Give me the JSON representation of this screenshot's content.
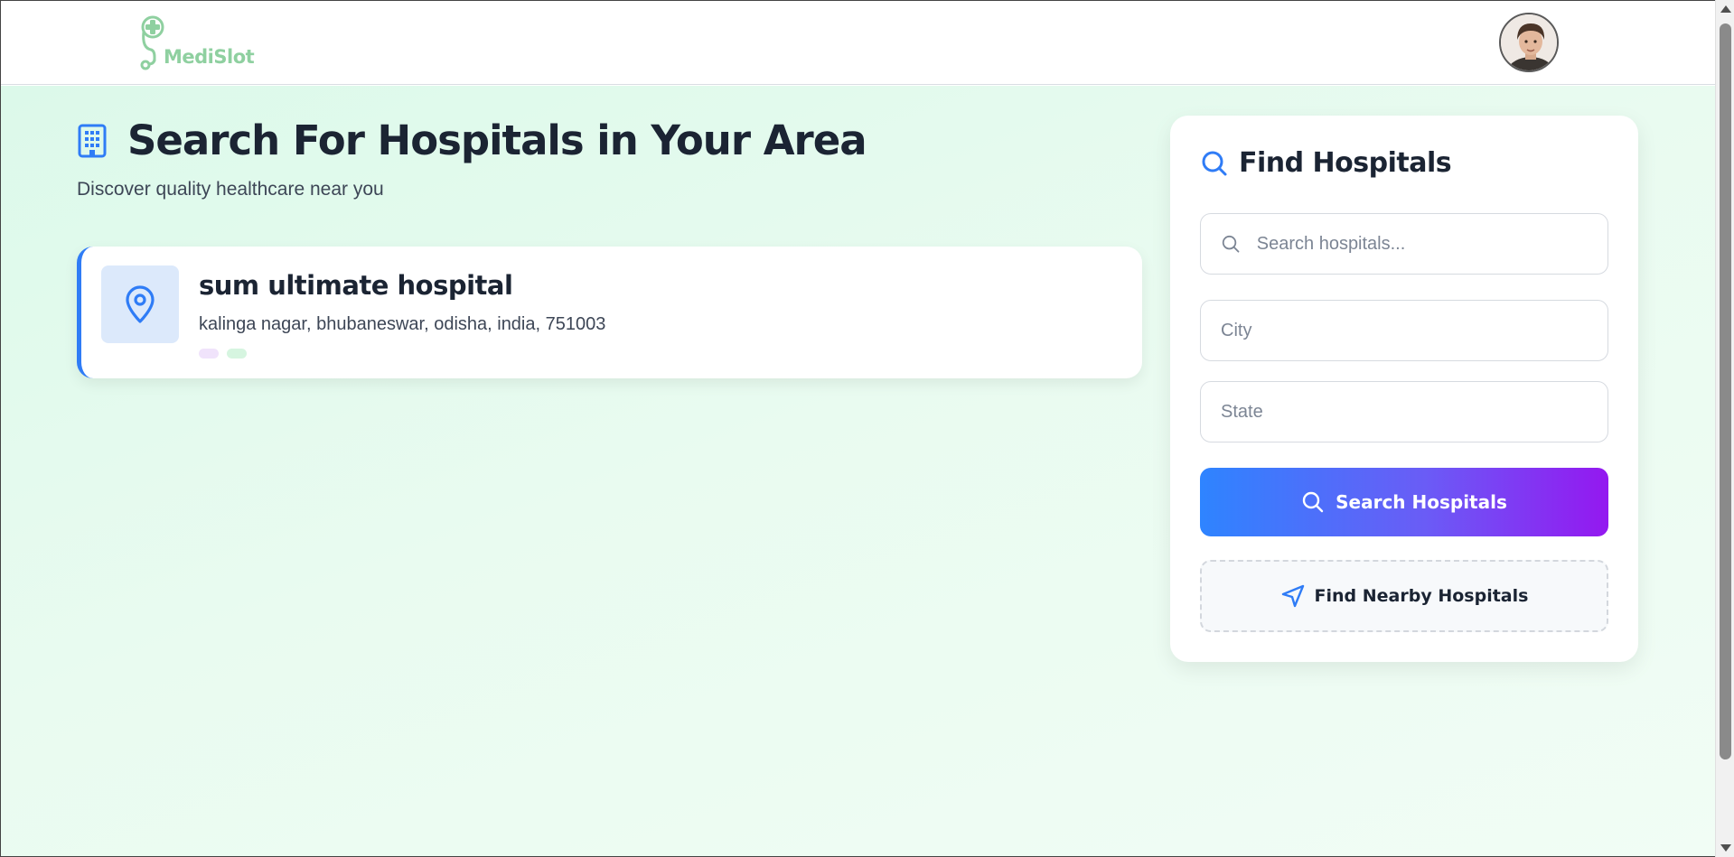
{
  "header": {
    "brand": "MediSlot",
    "logo_icon": "stethoscope-plus-icon",
    "avatar_icon": "user-avatar"
  },
  "main": {
    "title": "Search For Hospitals in Your Area",
    "title_icon": "building-icon",
    "subtitle": "Discover quality healthcare near you",
    "results": [
      {
        "name": "sum ultimate hospital",
        "address": "kalinga nagar, bhubaneswar, odisha, india, 751003",
        "icon": "map-pin-icon"
      }
    ]
  },
  "panel": {
    "title": "Find Hospitals",
    "title_icon": "search-icon",
    "search_placeholder": "Search hospitals...",
    "city_placeholder": "City",
    "state_placeholder": "State",
    "search_button": "Search Hospitals",
    "nearby_button": "Find Nearby Hospitals",
    "nearby_icon": "navigation-arrow-icon"
  },
  "colors": {
    "accent_blue": "#2f7cf6",
    "gradient_start": "#2e84ff",
    "gradient_end": "#9418f0",
    "brand_green": "#8fd0a0",
    "page_bg": "#e4faee"
  }
}
